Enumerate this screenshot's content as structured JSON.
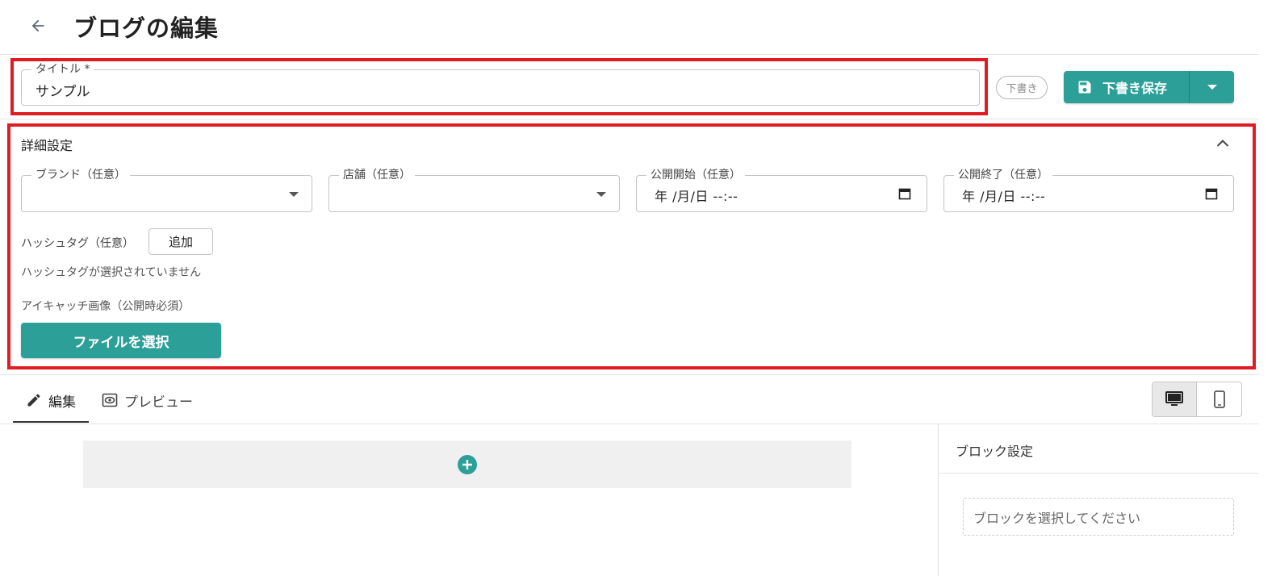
{
  "header": {
    "title": "ブログの編集"
  },
  "title_field": {
    "label": "タイトル *",
    "value": "サンプル"
  },
  "status": {
    "label": "下書き"
  },
  "save": {
    "label": "下書き保存"
  },
  "details": {
    "title": "詳細設定",
    "brand": {
      "label": "ブランド（任意）",
      "value": ""
    },
    "store": {
      "label": "店舗（任意）",
      "value": ""
    },
    "publish_start": {
      "label": "公開開始（任意）",
      "value": "年 /月/日 --:--"
    },
    "publish_end": {
      "label": "公開終了（任意）",
      "value": "年 /月/日 --:--"
    },
    "hashtag": {
      "label": "ハッシュタグ（任意）",
      "add_label": "追加",
      "empty_text": "ハッシュタグが選択されていません"
    },
    "eyecatch": {
      "label": "アイキャッチ画像（公開時必須）",
      "button_label": "ファイルを選択"
    }
  },
  "tabs": [
    {
      "label": "編集",
      "icon": "pencil-icon",
      "active": true
    },
    {
      "label": "プレビュー",
      "icon": "eye-icon",
      "active": false
    }
  ],
  "device_toggle": {
    "options": [
      "desktop-icon",
      "smartphone-icon"
    ],
    "selected": "desktop-icon"
  },
  "side_panel": {
    "title": "ブロック設定",
    "empty_text": "ブロックを選択してください"
  },
  "colors": {
    "accent": "#2c9f98",
    "highlight": "#e01b22"
  }
}
